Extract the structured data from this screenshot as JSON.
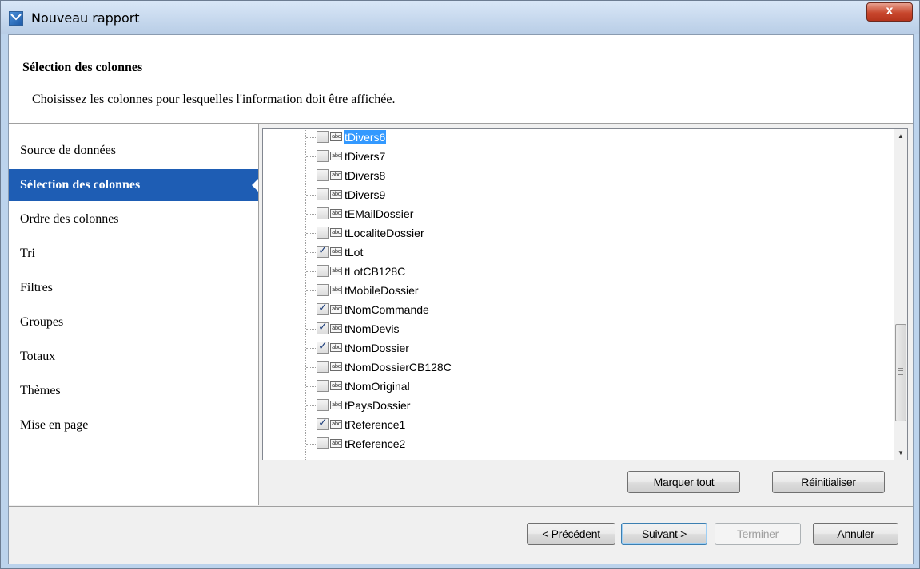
{
  "window": {
    "title": "Nouveau rapport",
    "close_glyph": "x"
  },
  "header": {
    "title": "Sélection des colonnes",
    "description": "Choisissez les colonnes pour lesquelles l'information doit être affichée."
  },
  "nav": {
    "items": [
      {
        "label": "Source de données",
        "active": false
      },
      {
        "label": "Sélection des colonnes",
        "active": true
      },
      {
        "label": "Ordre des colonnes",
        "active": false
      },
      {
        "label": "Tri",
        "active": false
      },
      {
        "label": "Filtres",
        "active": false
      },
      {
        "label": "Groupes",
        "active": false
      },
      {
        "label": "Totaux",
        "active": false
      },
      {
        "label": "Thèmes",
        "active": false
      },
      {
        "label": "Mise en page",
        "active": false
      }
    ]
  },
  "columns": {
    "type_icon_text": "abc",
    "items": [
      {
        "label": "tDivers6",
        "checked": false,
        "selected": true
      },
      {
        "label": "tDivers7",
        "checked": false,
        "selected": false
      },
      {
        "label": "tDivers8",
        "checked": false,
        "selected": false
      },
      {
        "label": "tDivers9",
        "checked": false,
        "selected": false
      },
      {
        "label": "tEMailDossier",
        "checked": false,
        "selected": false
      },
      {
        "label": "tLocaliteDossier",
        "checked": false,
        "selected": false
      },
      {
        "label": "tLot",
        "checked": true,
        "selected": false
      },
      {
        "label": "tLotCB128C",
        "checked": false,
        "selected": false
      },
      {
        "label": "tMobileDossier",
        "checked": false,
        "selected": false
      },
      {
        "label": "tNomCommande",
        "checked": true,
        "selected": false
      },
      {
        "label": "tNomDevis",
        "checked": true,
        "selected": false
      },
      {
        "label": "tNomDossier",
        "checked": true,
        "selected": false
      },
      {
        "label": "tNomDossierCB128C",
        "checked": false,
        "selected": false
      },
      {
        "label": "tNomOriginal",
        "checked": false,
        "selected": false
      },
      {
        "label": "tPaysDossier",
        "checked": false,
        "selected": false
      },
      {
        "label": "tReference1",
        "checked": true,
        "selected": false
      },
      {
        "label": "tReference2",
        "checked": false,
        "selected": false
      }
    ],
    "scroll_position": 0.7
  },
  "list_buttons": {
    "mark_all": "Marquer tout",
    "reset": "Réinitialiser"
  },
  "footer": {
    "previous": "< Précédent",
    "next": "Suivant >",
    "finish": "Terminer",
    "cancel": "Annuler"
  }
}
